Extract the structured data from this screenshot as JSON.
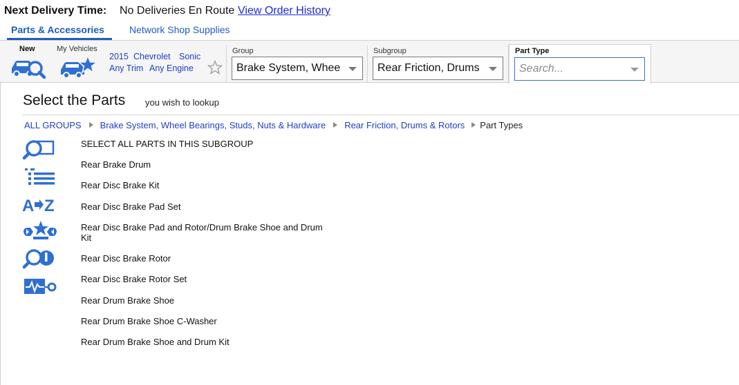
{
  "header": {
    "delivery_label": "Next Delivery Time:",
    "delivery_value": "No Deliveries En Route",
    "order_history_link": "View Order History"
  },
  "tabs": [
    {
      "label": "Parts & Accessories",
      "active": true
    },
    {
      "label": "Network Shop Supplies",
      "active": false
    }
  ],
  "vehicle": {
    "new_label": "New",
    "my_vehicles_label": "My Vehicles",
    "year": "2015",
    "make": "Chevrolet",
    "model": "Sonic",
    "trim": "Any Trim",
    "engine": "Any Engine"
  },
  "dropdowns": {
    "group": {
      "label": "Group",
      "value": "Brake System, Whee"
    },
    "subgroup": {
      "label": "Subgroup",
      "value": "Rear Friction, Drums"
    },
    "part_type": {
      "label": "Part Type",
      "placeholder": "Search..."
    }
  },
  "main": {
    "title": "Select the Parts",
    "subtitle": "you wish to lookup",
    "breadcrumb": {
      "all_groups": "ALL GROUPS",
      "group": "Brake System, Wheel Bearings, Studs, Nuts & Hardware",
      "subgroup": "Rear Friction, Drums & Rotors",
      "current": "Part Types"
    },
    "side_icons": [
      "parts-search-icon",
      "list-view-icon",
      "a-to-z-sort-icon",
      "tools-star-icon",
      "search-wrench-icon",
      "diagnostics-icon"
    ],
    "parts": [
      "SELECT ALL PARTS IN THIS SUBGROUP",
      "Rear Brake Drum",
      "Rear Disc Brake Kit",
      "Rear Disc Brake Pad Set",
      "Rear Disc Brake Pad and Rotor/Drum Brake Shoe and Drum Kit",
      "Rear Disc Brake Rotor",
      "Rear Disc Brake Rotor Set",
      "Rear Drum Brake Shoe",
      "Rear Drum Brake Shoe C-Washer",
      "Rear Drum Brake Shoe and Drum Kit"
    ]
  },
  "colors": {
    "accent": "#1f5bbf",
    "link": "#1a2bd6",
    "icon": "#2f6fd1"
  }
}
